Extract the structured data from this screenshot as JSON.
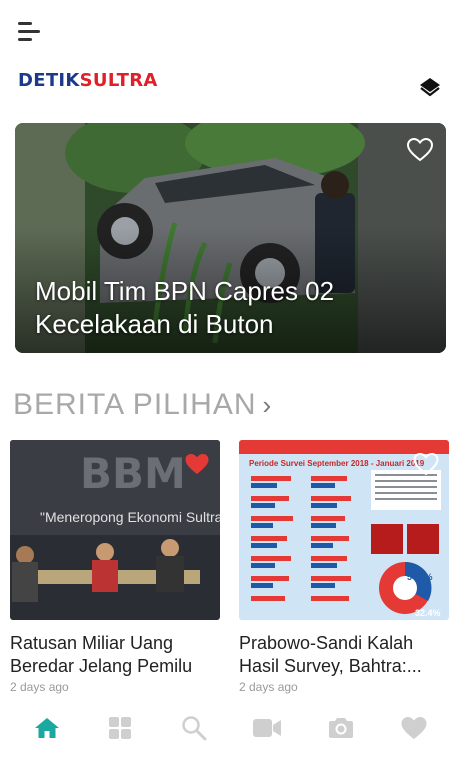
{
  "app": {
    "logo_part1": "DETIK",
    "logo_part2": "SULTRA"
  },
  "hero": {
    "title": "Mobil Tim BPN Capres 02 Kecelakaan di Buton",
    "favorited": false
  },
  "section": {
    "title": "BERITA PILIHAN",
    "chevron": "›"
  },
  "articles": [
    {
      "title": "Ratusan Miliar Uang Beredar Jelang Pemilu",
      "date": "2 days ago",
      "favorited": true,
      "image_text_large": "BBM",
      "image_text_small": "\"Meneropong Ekonomi Sultra"
    },
    {
      "title": "Prabowo-Sandi Kalah Hasil Survey, Bahtra:...",
      "date": "2 days ago",
      "favorited": false,
      "image_text_header": "Periode Survei September 2018 - Januari 2019",
      "image_text_percent_1": "54.9%",
      "image_text_percent_2": "32.4%"
    }
  ],
  "bottom_nav": [
    {
      "name": "home",
      "icon": "home-icon",
      "active": true
    },
    {
      "name": "categories",
      "icon": "grid-icon",
      "active": false
    },
    {
      "name": "search",
      "icon": "search-icon",
      "active": false
    },
    {
      "name": "video",
      "icon": "video-icon",
      "active": false
    },
    {
      "name": "photo",
      "icon": "camera-icon",
      "active": false
    },
    {
      "name": "favorites",
      "icon": "heart-icon",
      "active": false
    }
  ],
  "colors": {
    "accent": "#1aa8a0",
    "nav_inactive": "#cfcfcf",
    "heart_active": "#e53935",
    "logo_blue": "#1d3a8a",
    "logo_red": "#e02028"
  }
}
